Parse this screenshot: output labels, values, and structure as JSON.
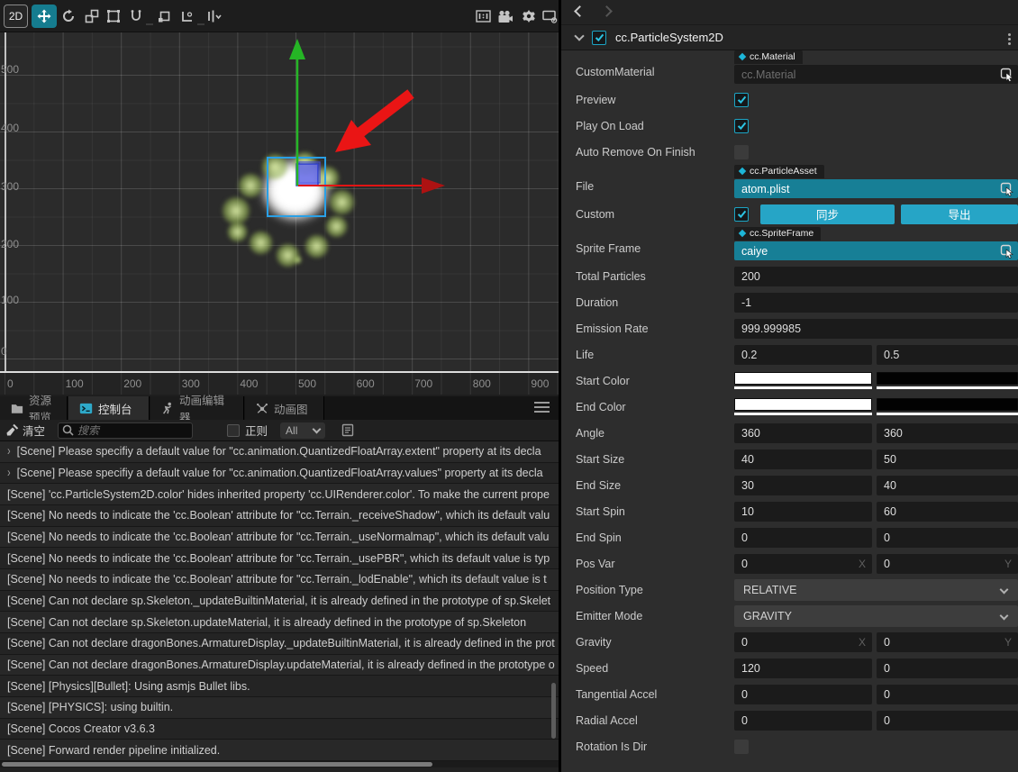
{
  "scene": {
    "toolbar": {
      "mode_label": "2D",
      "left_icons": [
        "move-tool",
        "rotate-tool",
        "scale-tool",
        "rect-tool",
        "uniform-transform-tool",
        "snap-corner-tool",
        "snap-angle-tool",
        "gizmo-settings-tool"
      ],
      "right_icons": [
        "aspect-ratio-icon",
        "camera-icon",
        "gear-icon",
        "display-export-icon"
      ]
    },
    "y_axis_labels": [
      "500",
      "400",
      "300",
      "200",
      "100",
      "0"
    ],
    "x_axis_labels": [
      "0",
      "100",
      "200",
      "300",
      "400",
      "500",
      "600",
      "700",
      "800",
      "900"
    ]
  },
  "console": {
    "tabs": [
      {
        "label": "资源预览",
        "icon": "folder-icon",
        "active": false
      },
      {
        "label": "控制台",
        "icon": "terminal-icon",
        "active": true
      },
      {
        "label": "动画编辑器",
        "icon": "animation-editor-icon",
        "active": false
      },
      {
        "label": "动画图",
        "icon": "animation-graph-icon",
        "active": false
      }
    ],
    "toolbar": {
      "clear_label": "清空",
      "search_placeholder": "搜索",
      "regex_label": "正则",
      "filter_value": "All"
    },
    "logs": [
      {
        "expandable": true,
        "text": "[Scene] Please specifiy a default value for \"cc.animation.QuantizedFloatArray.extent\" property at its decla"
      },
      {
        "expandable": true,
        "text": "[Scene] Please specifiy a default value for \"cc.animation.QuantizedFloatArray.values\" property at its decla"
      },
      {
        "expandable": false,
        "text": "[Scene] 'cc.ParticleSystem2D.color' hides inherited property 'cc.UIRenderer.color'. To make the current prope"
      },
      {
        "expandable": false,
        "text": "[Scene] No needs to indicate the 'cc.Boolean' attribute for \"cc.Terrain._receiveShadow\", which its default valu"
      },
      {
        "expandable": false,
        "text": "[Scene] No needs to indicate the 'cc.Boolean' attribute for \"cc.Terrain._useNormalmap\", which its default valu"
      },
      {
        "expandable": false,
        "text": "[Scene] No needs to indicate the 'cc.Boolean' attribute for \"cc.Terrain._usePBR\", which its default value is typ"
      },
      {
        "expandable": false,
        "text": "[Scene] No needs to indicate the 'cc.Boolean' attribute for \"cc.Terrain._lodEnable\", which its default value is t"
      },
      {
        "expandable": false,
        "text": "[Scene] Can not declare sp.Skeleton._updateBuiltinMaterial, it is already defined in the prototype of sp.Skelet"
      },
      {
        "expandable": false,
        "text": "[Scene] Can not declare sp.Skeleton.updateMaterial, it is already defined in the prototype of sp.Skeleton"
      },
      {
        "expandable": false,
        "text": "[Scene] Can not declare dragonBones.ArmatureDisplay._updateBuiltinMaterial, it is already defined in the prot"
      },
      {
        "expandable": false,
        "text": "[Scene] Can not declare dragonBones.ArmatureDisplay.updateMaterial, it is already defined in the prototype o"
      },
      {
        "expandable": false,
        "text": "[Scene] [Physics][Bullet]: Using asmjs Bullet libs."
      },
      {
        "expandable": false,
        "text": "[Scene] [PHYSICS]: using builtin."
      },
      {
        "expandable": false,
        "text": "[Scene] Cocos Creator v3.6.3"
      },
      {
        "expandable": false,
        "text": "[Scene] Forward render pipeline initialized."
      }
    ]
  },
  "inspector": {
    "header": {
      "title": "cc.ParticleSystem2D",
      "enabled": true
    },
    "rows": [
      {
        "label": "CustomMaterial",
        "type": "asset",
        "badge": "cc.Material",
        "value": "",
        "placeholder": "cc.Material",
        "teal": false
      },
      {
        "label": "Preview",
        "type": "checkbox",
        "checked": true
      },
      {
        "label": "Play On Load",
        "type": "checkbox",
        "checked": true
      },
      {
        "label": "Auto Remove On Finish",
        "type": "checkbox",
        "checked": false
      },
      {
        "label": "File",
        "type": "asset",
        "badge": "cc.ParticleAsset",
        "value": "atom.plist",
        "teal": true
      },
      {
        "label": "Custom",
        "type": "check-buttons",
        "checked": true,
        "buttons": [
          "同步",
          "导出"
        ]
      },
      {
        "label": "Sprite Frame",
        "type": "asset",
        "badge": "cc.SpriteFrame",
        "value": "caiye",
        "teal": true
      },
      {
        "label": "Total Particles",
        "type": "field",
        "value": "200"
      },
      {
        "label": "Duration",
        "type": "field",
        "value": "-1"
      },
      {
        "label": "Emission Rate",
        "type": "field",
        "value": "999.999985"
      },
      {
        "label": "Life",
        "type": "pair",
        "values": [
          "0.2",
          "0.5"
        ]
      },
      {
        "label": "Start Color",
        "type": "color-pair",
        "colors": [
          "#ffffff",
          "#020202"
        ]
      },
      {
        "label": "End Color",
        "type": "color-pair",
        "colors": [
          "#ffffff",
          "#020202"
        ]
      },
      {
        "label": "Angle",
        "type": "pair",
        "values": [
          "360",
          "360"
        ]
      },
      {
        "label": "Start Size",
        "type": "pair",
        "values": [
          "40",
          "50"
        ]
      },
      {
        "label": "End Size",
        "type": "pair",
        "values": [
          "30",
          "40"
        ]
      },
      {
        "label": "Start Spin",
        "type": "pair",
        "values": [
          "10",
          "60"
        ]
      },
      {
        "label": "End Spin",
        "type": "pair",
        "values": [
          "0",
          "0"
        ]
      },
      {
        "label": "Pos Var",
        "type": "xy-pair",
        "values": [
          "0",
          "0"
        ],
        "suffixes": [
          "X",
          "Y"
        ]
      },
      {
        "label": "Position Type",
        "type": "select",
        "value": "RELATIVE"
      },
      {
        "label": "Emitter Mode",
        "type": "select",
        "value": "GRAVITY"
      },
      {
        "label": "Gravity",
        "type": "xy-pair",
        "values": [
          "0",
          "0"
        ],
        "suffixes": [
          "X",
          "Y"
        ]
      },
      {
        "label": "Speed",
        "type": "pair",
        "values": [
          "120",
          "0"
        ]
      },
      {
        "label": "Tangential Accel",
        "type": "pair",
        "values": [
          "0",
          "0"
        ]
      },
      {
        "label": "Radial Accel",
        "type": "pair",
        "values": [
          "0",
          "0"
        ]
      },
      {
        "label": "Rotation Is Dir",
        "type": "checkbox",
        "checked": false
      }
    ]
  },
  "colors": {
    "accent_teal_field": "#177f96",
    "accent_teal_button": "#26a5c6",
    "accent_cyan": "#1db6d8",
    "gizmo_green": "#25b525",
    "gizmo_red": "#e21414",
    "selection_blue": "#2aa0e6"
  }
}
